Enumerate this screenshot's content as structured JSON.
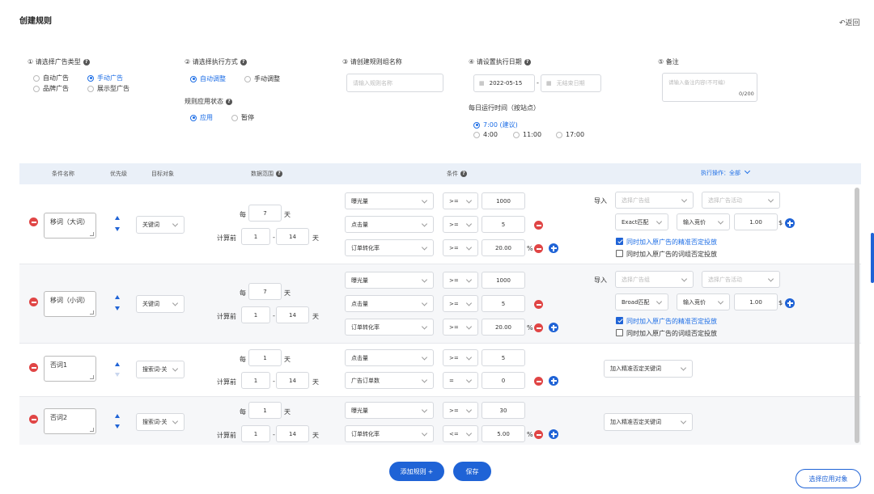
{
  "header": {
    "title": "创建规则",
    "back": "返回"
  },
  "steps": {
    "s1": {
      "label": "① 请选择广告类型",
      "opts": [
        "自动广告",
        "手动广告",
        "品牌广告",
        "展示型广告"
      ]
    },
    "s2": {
      "label": "② 请选择执行方式",
      "opts": [
        "自动调整",
        "手动调整"
      ],
      "status_label": "规则应用状态",
      "status_opts": [
        "应用",
        "暂停"
      ]
    },
    "s3": {
      "label": "③ 请创建规则组名称",
      "placeholder": "请输入规则名称"
    },
    "s4": {
      "label": "④ 请设置执行日期",
      "start": "2022-05-15",
      "end_placeholder": "无结束日期",
      "time_label": "每日运行时间（按站点）",
      "times": [
        "7:00 (建议)",
        "4:00",
        "11:00",
        "17:00"
      ]
    },
    "s5": {
      "label": "⑤ 备注",
      "placeholder": "请输入备注内容(不可编)",
      "count": "0/200"
    }
  },
  "table": {
    "headers": {
      "name": "条件名称",
      "priority": "优先级",
      "target": "目标对象",
      "range": "数据范围",
      "cond": "条件",
      "action": "执行操作：全部"
    },
    "common": {
      "every": "每",
      "days": "天",
      "calc_prefix": "计算前",
      "dash": "-",
      "import": "导入",
      "adgroup_ph": "选择广告组",
      "campaign_ph": "选择广告活动",
      "bid_label": "输入竞价",
      "cb1": "同时加入原广告的精准否定投放",
      "cb2": "同时加入原广告的词组否定投放",
      "pct": "%",
      "dollar": "$"
    },
    "rows": [
      {
        "name": "移词（大词）",
        "target": "关键词",
        "every": "7",
        "from": "1",
        "to": "14",
        "conds": [
          {
            "metric": "曝光量",
            "op": ">=",
            "val": "1000"
          },
          {
            "metric": "点击量",
            "op": ">=",
            "val": "5"
          },
          {
            "metric": "订单转化率",
            "op": ">=",
            "val": "20.00"
          }
        ],
        "match": "Exact匹配",
        "bid": "1.00"
      },
      {
        "name": "移词（小词）",
        "target": "关键词",
        "every": "7",
        "from": "1",
        "to": "14",
        "conds": [
          {
            "metric": "曝光量",
            "op": ">=",
            "val": "1000"
          },
          {
            "metric": "点击量",
            "op": ">=",
            "val": "5"
          },
          {
            "metric": "订单转化率",
            "op": ">=",
            "val": "20.00"
          }
        ],
        "match": "Broad匹配",
        "bid": "1.00"
      },
      {
        "name": "否词1",
        "target": "搜索词-关",
        "every": "1",
        "from": "1",
        "to": "14",
        "conds": [
          {
            "metric": "点击量",
            "op": ">=",
            "val": "5"
          },
          {
            "metric": "广告订单数",
            "op": "=",
            "val": "0"
          }
        ],
        "action": "加入精准否定关键词"
      },
      {
        "name": "否词2",
        "target": "搜索词-关",
        "every": "1",
        "from": "1",
        "to": "14",
        "conds": [
          {
            "metric": "曝光量",
            "op": ">=",
            "val": "30"
          },
          {
            "metric": "订单转化率",
            "op": "<=",
            "val": "5.00"
          }
        ],
        "action": "加入精准否定关键词"
      }
    ]
  },
  "footer": {
    "add": "添加规则",
    "save": "保存",
    "apply": "选择应用对象"
  },
  "colors": {
    "primary": "#1f63d6",
    "danger": "#e04545"
  }
}
